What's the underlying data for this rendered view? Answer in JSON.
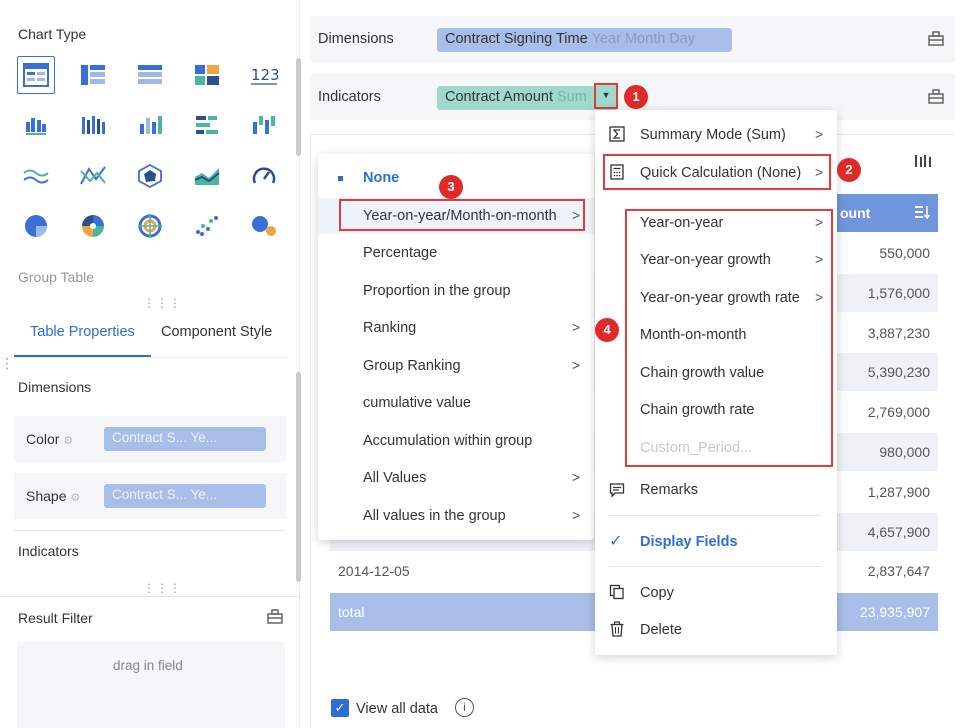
{
  "left_panel": {
    "chart_type_title": "Chart Type",
    "chart_icons": [
      "group-table-icon",
      "cross-table-icon",
      "detail-table-icon",
      "kpi-blocks-icon",
      "number-card-icon",
      "grouped-bar-icon",
      "multi-column-icon",
      "column-chart-icon",
      "horizontal-bar-icon",
      "stacked-column-icon",
      "wave-line-icon",
      "line-cross-icon",
      "radar-icon",
      "area-chart-icon",
      "gauge-icon",
      "pie-chart-icon",
      "donut-pie-icon",
      "ring-target-icon",
      "scatter-icon",
      "bubble-icon"
    ],
    "selected_chart_label": "Group Table",
    "number_card_text": "123",
    "tabs": [
      "Table Properties",
      "Component Style"
    ],
    "dimensions_title": "Dimensions",
    "color_label": "Color",
    "color_chip": "Contract S...  Ye...",
    "shape_label": "Shape",
    "shape_chip": "Contract S...  Ye...",
    "indicators_title": "Indicators",
    "result_filter_title": "Result Filter",
    "drag_hint": "drag in field"
  },
  "top": {
    "dimensions_label": "Dimensions",
    "dimension_chip": "Contract Signing Time",
    "dimension_chip_sub": "Year Month Day",
    "indicators_label": "Indicators",
    "indicator_chip": "Contract Amount",
    "indicator_chip_sub": "Sum"
  },
  "table": {
    "header": "ount",
    "rows": [
      {
        "date": "",
        "value": "550,000"
      },
      {
        "date": "",
        "value": "1,576,000"
      },
      {
        "date": "",
        "value": "3,887,230"
      },
      {
        "date": "",
        "value": "5,390,230"
      },
      {
        "date": "",
        "value": "2,769,000"
      },
      {
        "date": "",
        "value": "980,000"
      },
      {
        "date": "",
        "value": "1,287,900"
      },
      {
        "date": "",
        "value": "4,657,900"
      },
      {
        "date": "2014-12-05",
        "value": "2,837,647"
      }
    ],
    "total_label": "total",
    "total_value": "23,935,907",
    "view_all": "View all data"
  },
  "indicator_menu": {
    "summary_mode": "Summary Mode (Sum)",
    "quick_calc": "Quick Calculation (None)",
    "remarks": "Remarks",
    "display_fields": "Display Fields",
    "copy": "Copy",
    "delete": "Delete"
  },
  "yoy_submenu": {
    "items": [
      "Year-on-year",
      "Year-on-year growth",
      "Year-on-year growth rate",
      "Month-on-month",
      "Chain growth value",
      "Chain growth rate",
      "Custom_Period..."
    ]
  },
  "quick_calc_submenu": {
    "items": [
      "None",
      "Year-on-year/Month-on-month",
      "Percentage",
      "Proportion in the group",
      "Ranking",
      "Group Ranking",
      "cumulative value",
      "Accumulation within group",
      "All Values",
      "All values in the group"
    ]
  },
  "badges": [
    "1",
    "2",
    "3",
    "4"
  ],
  "colors": {
    "accent": "#2d6fd6",
    "annotation_red": "#e23b3b",
    "table_header": "#6f95dc"
  }
}
